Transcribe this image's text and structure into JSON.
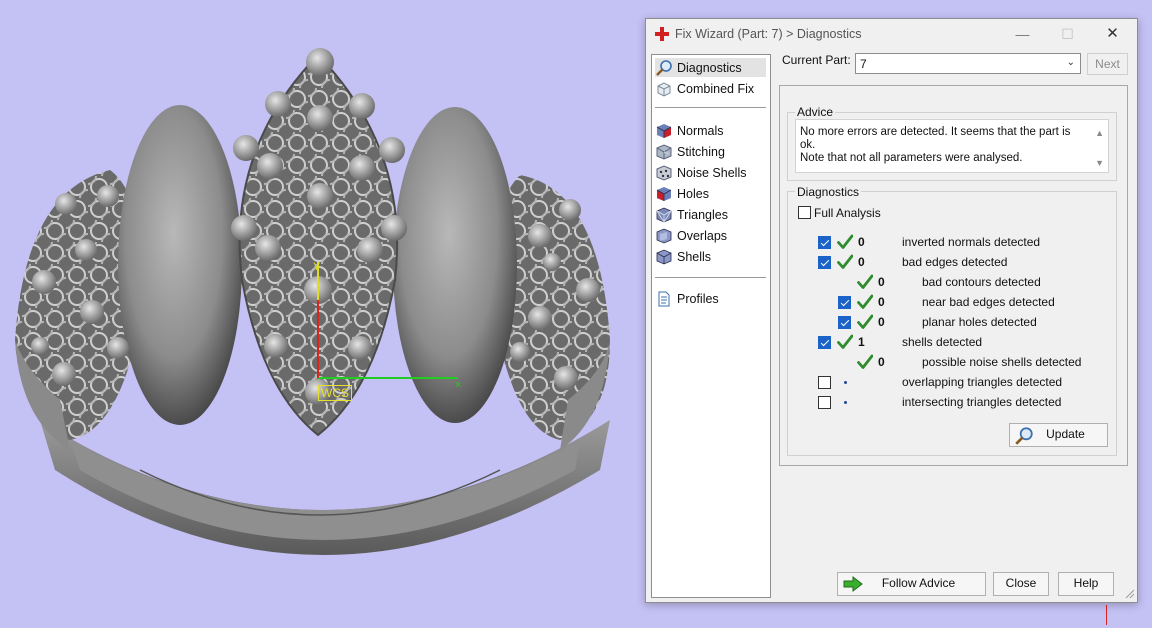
{
  "window": {
    "title": "Fix Wizard (Part: 7) > Diagnostics",
    "minimize": "—",
    "maximize": "☐",
    "close": "✕"
  },
  "viewport": {
    "wcs_label": "WCS",
    "axis_x_color": "#22cc22",
    "axis_y_color": "#dddd22",
    "axis_z_color": "#dd2222"
  },
  "nav": {
    "items": [
      {
        "label": "Diagnostics",
        "icon": "magnifier-icon",
        "selected": true
      },
      {
        "label": "Combined Fix",
        "icon": "cube-icon"
      },
      {
        "label": "Normals",
        "icon": "normals-cube-icon"
      },
      {
        "label": "Stitching",
        "icon": "stitching-cube-icon"
      },
      {
        "label": "Noise Shells",
        "icon": "noise-shells-icon"
      },
      {
        "label": "Holes",
        "icon": "holes-cube-icon"
      },
      {
        "label": "Triangles",
        "icon": "triangles-cube-icon"
      },
      {
        "label": "Overlaps",
        "icon": "overlaps-cube-icon"
      },
      {
        "label": "Shells",
        "icon": "shells-cube-icon"
      },
      {
        "label": "Profiles",
        "icon": "document-icon"
      }
    ]
  },
  "current_part": {
    "label": "Current Part:",
    "value": "7",
    "next_label": "Next"
  },
  "advice": {
    "title": "Advice",
    "line1": "No more errors are detected. It seems that the part is ok.",
    "line2": "Note that not all parameters were analysed."
  },
  "diagnostics": {
    "title": "Diagnostics",
    "full_analysis_label": "Full Analysis",
    "full_analysis_checked": false,
    "rows": [
      {
        "checkbox": true,
        "checked": true,
        "status": "ok",
        "count": "0",
        "label": "inverted normals detected",
        "indent": 0
      },
      {
        "checkbox": true,
        "checked": true,
        "status": "ok",
        "count": "0",
        "label": "bad edges detected",
        "indent": 0
      },
      {
        "checkbox": false,
        "status": "ok",
        "count": "0",
        "label": "bad contours detected",
        "indent": 1
      },
      {
        "checkbox": true,
        "checked": true,
        "status": "ok",
        "count": "0",
        "label": "near bad edges detected",
        "indent": 1
      },
      {
        "checkbox": true,
        "checked": true,
        "status": "ok",
        "count": "0",
        "label": "planar holes detected",
        "indent": 1
      },
      {
        "checkbox": true,
        "checked": true,
        "status": "ok",
        "count": "1",
        "label": "shells detected",
        "indent": 0
      },
      {
        "checkbox": false,
        "status": "ok",
        "count": "0",
        "label": "possible noise shells detected",
        "indent": 1
      },
      {
        "checkbox": true,
        "checked": false,
        "status": "pending",
        "count": "",
        "label": "overlapping triangles detected",
        "indent": 0
      },
      {
        "checkbox": true,
        "checked": false,
        "status": "pending",
        "count": "",
        "label": "intersecting triangles detected",
        "indent": 0
      }
    ],
    "update_label": "Update"
  },
  "footer": {
    "follow_advice_label": "Follow Advice",
    "close_label": "Close",
    "help_label": "Help"
  },
  "colors": {
    "viewport_bg": "#c4c1f4",
    "check_green": "#2e8b2e",
    "checkbox_blue": "#1b63c9",
    "title_icon_red": "#d21f1f"
  }
}
